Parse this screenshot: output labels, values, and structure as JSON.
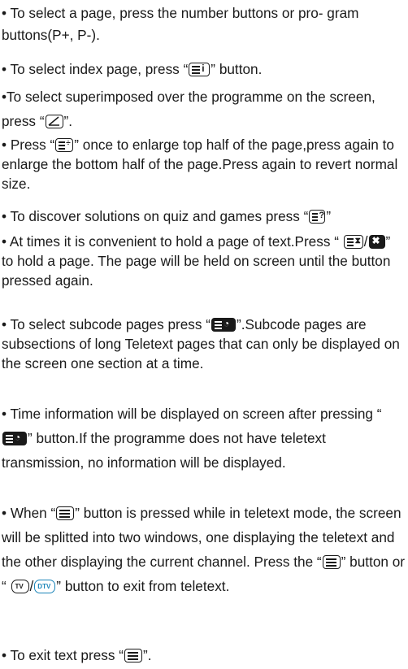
{
  "quote_open": "“",
  "quote_close": "”",
  "bullet": "•",
  "items": [
    {
      "text": "To select a page, press the number buttons or pro- gram buttons(P+, P-)."
    },
    {
      "before": "To select index page, press",
      "icon": "index-icon",
      "after": "button."
    },
    {
      "before": "To select superimposed over the programme on the screen, press",
      "icon": "mix-icon",
      "after": "."
    },
    {
      "before": "Press",
      "icon": "size-icon",
      "after": "once to enlarge top half of the page,press again to enlarge the bottom half of the page.Press again to revert normal size."
    },
    {
      "before": "To discover solutions on quiz and games press",
      "icon": "reveal-icon",
      "after": ""
    },
    {
      "before": "At times it is convenient to hold a page of text.Press",
      "icon": "hold-icon",
      "after": "to hold a page. The page will be held on screen until the button pressed again."
    },
    {
      "before": "To select subcode pages press",
      "icon": "subcode-icon",
      "after": ".Subcode pages are subsections of long Teletext pages that can only be displayed on the screen one section at a time."
    },
    {
      "before": "Time information will be displayed on screen after pressing",
      "icon": "time-icon",
      "after": "button.If the programme does not have teletext transmission, no information will be displayed."
    },
    {
      "before": "When",
      "icon": "text-icon",
      "middle": "button is pressed while in teletext mode, the screen will be splitted into two windows, one displaying the teletext and the other displaying the current channel. Press the",
      "icon2": "text-icon",
      "middle2": "button or",
      "icon3": "tv-dtv-icon",
      "after": "button to exit from teletext."
    },
    {
      "before": "To exit text press",
      "icon": "text-icon",
      "after": "."
    }
  ],
  "tv_label": "TV",
  "dtv_label": "DTV",
  "slash": "/",
  "colors": {
    "text": "#1a1a1a",
    "tv_blue": "#1a84b8"
  }
}
